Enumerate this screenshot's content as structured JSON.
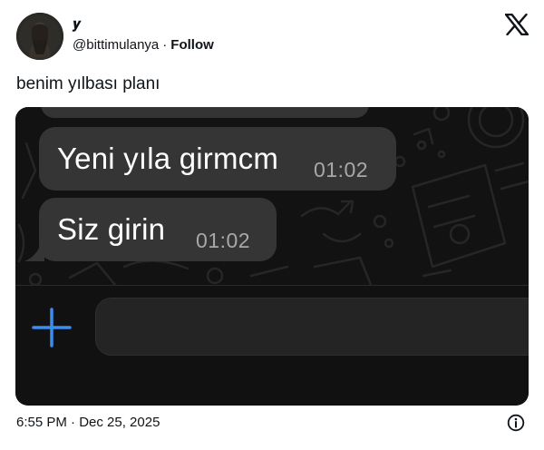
{
  "tweet": {
    "display_name": "𝒚",
    "handle": "@bittimulanya",
    "separator": "·",
    "follow_label": "Follow",
    "text": "benim yılbası planı",
    "timestamp": "6:55 PM · Dec 25, 2025",
    "icons": {
      "brand": "x-logo-icon",
      "info": "info-icon"
    }
  },
  "chat": {
    "messages": [
      {
        "text": "Yeni yıla girmcm",
        "time": "01:02"
      },
      {
        "text": "Siz girin",
        "time": "01:02"
      }
    ],
    "composer": {
      "add_icon": "plus-icon",
      "accent_color": "#3b8ef0"
    }
  }
}
